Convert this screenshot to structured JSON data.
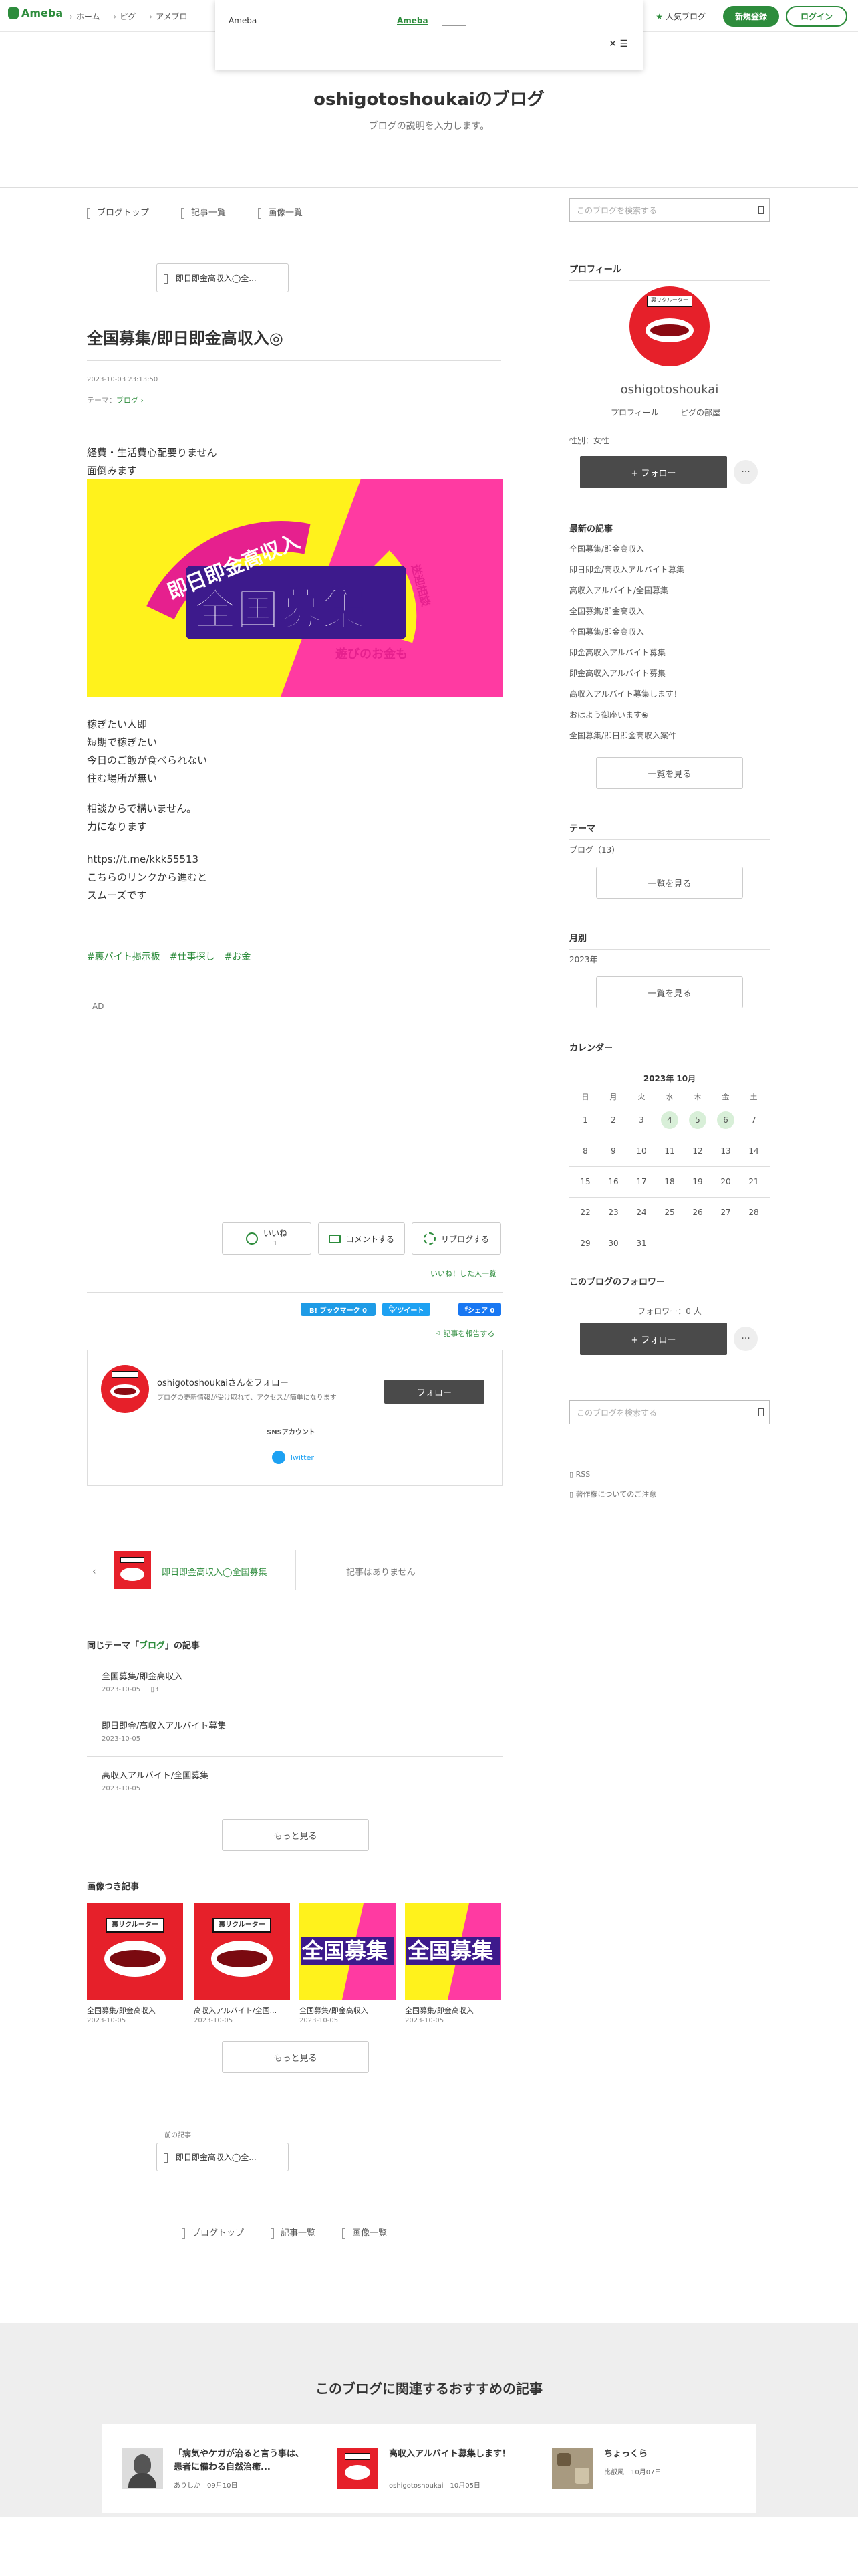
{
  "topbar": {
    "logo": "Ameba",
    "nav": [
      "ホーム",
      "ピグ",
      "アメブロ"
    ],
    "popular": "人気ブログ",
    "register": "新規登録",
    "login": "ログイン"
  },
  "popup": {
    "title": "Ameba",
    "link": "Ameba",
    "close": "✕ ☰"
  },
  "blog": {
    "title": "oshigotoshoukaiのブログ",
    "description": "ブログの説明を入力します。"
  },
  "blognav": {
    "items": [
      "ブログトップ",
      "記事一覧",
      "画像一覧"
    ],
    "search_placeholder": "このブログを検索する"
  },
  "article": {
    "prev_label": "即日即金高収入◯全...",
    "title": "全国募集/即日即金高収入◎",
    "date": "2023-10-03 23:13:50",
    "theme_label": "テーマ：",
    "theme": "ブログ",
    "para1": [
      "経費・生活費心配要りません",
      "面倒みます"
    ],
    "banner": {
      "arc_left": "即日即金高収入",
      "main": "全国募集",
      "arc_right": "遊びのお金も",
      "side_right": "送迎相談"
    },
    "para2": [
      "稼ぎたい人即",
      "短期で稼ぎたい",
      "今日のご飯が食べられない",
      "住む場所が無い"
    ],
    "para3": [
      "相談からで構いません。",
      "力になります"
    ],
    "para4": [
      "https://t.me/kkk55513",
      "こちらのリンクから進むと",
      "スムーズです"
    ],
    "hashtags": [
      "#裏バイト掲示板",
      "#仕事探し",
      "#お金"
    ],
    "ad": "AD"
  },
  "actions": {
    "like": "いいね",
    "like_count": "1",
    "comment": "コメントする",
    "reblog": "リブログする",
    "liked_by": "いいね！した人一覧",
    "bookmark": "B! ブックマーク 0",
    "tweet": "ツイート",
    "fb_share": "シェア 0",
    "report": "記事を報告する"
  },
  "follow_card": {
    "name": "oshigotoshoukaiさんをフォロー",
    "desc": "ブログの更新情報が受け取れて、アクセスが簡単になります",
    "button": "フォロー",
    "sns_label": "SNSアカウント",
    "twitter": "Twitter"
  },
  "nav_posts": {
    "prev_title": "即日即金高収入◯全国募集",
    "next_none": "記事はありません"
  },
  "same_theme": {
    "prefix": "同じテーマ「",
    "theme": "ブログ",
    "suffix": "」の記事",
    "items": [
      {
        "title": "全国募集/即金高収入",
        "date": "2023-10-05",
        "extra": "3"
      },
      {
        "title": "即日即金/高収入アルバイト募集",
        "date": "2023-10-05"
      },
      {
        "title": "高収入アルバイト/全国募集",
        "date": "2023-10-05"
      }
    ],
    "more": "もっと見る"
  },
  "image_posts": {
    "title": "画像つき記事",
    "items": [
      {
        "caption": "全国募集/即金高収入",
        "date": "2023-10-05",
        "kind": "lips"
      },
      {
        "caption": "高収入アルバイト/全国...",
        "date": "2023-10-05",
        "kind": "lips"
      },
      {
        "caption": "全国募集/即金高収入",
        "date": "2023-10-05",
        "kind": "banner"
      },
      {
        "caption": "全国募集/即金高収入",
        "date": "2023-10-05",
        "kind": "banner"
      }
    ],
    "lips_tag": "裏リクルーター",
    "banner_text": "全国募集",
    "more": "もっと見る"
  },
  "prev_post": {
    "label": "前の記事",
    "title": "即日即金高収入◯全..."
  },
  "bottomnav": [
    "ブログトップ",
    "記事一覧",
    "画像一覧"
  ],
  "sidebar": {
    "profile_title": "プロフィール",
    "profile_name": "oshigotoshoukai",
    "profile_link": "プロフィール",
    "pigg_link": "ピグの部屋",
    "gender": "性別：女性",
    "follow_button": "+ フォロー",
    "more_button": "···",
    "latest_title": "最新の記事",
    "latest": [
      "全国募集/即金高収入",
      "即日即金/高収入アルバイト募集",
      "高収入アルバイト/全国募集",
      "全国募集/即金高収入",
      "全国募集/即金高収入",
      "即金高収入アルバイト募集",
      "即金高収入アルバイト募集",
      "高収入アルバイト募集します！",
      "おはよう御座います❀",
      "全国募集/即日即金高収入案件"
    ],
    "see_all": "一覧を見る",
    "theme_title": "テーマ",
    "theme_item": "ブログ（13）",
    "monthly_title": "月別",
    "monthly_item": "2023年",
    "calendar_title": "カレンダー",
    "calendar_month": "2023年 10月",
    "weekdays": [
      "日",
      "月",
      "火",
      "水",
      "木",
      "金",
      "土"
    ],
    "highlight_days": [
      4,
      5,
      6
    ],
    "followers_title": "このブログのフォロワー",
    "followers_count": "フォロワー：0 人",
    "search_placeholder": "このブログを検索する",
    "rss": "RSS",
    "copyright": "著作権についてのご注意"
  },
  "recommend": {
    "title": "このブログに関連するおすすめの記事",
    "items": [
      {
        "title": "「病気やケガが治ると言う事は、患者に備わる自然治癒...",
        "author": "ありしか",
        "date": "09月10日"
      },
      {
        "title": "高収入アルバイト募集します！",
        "author": "oshigotoshoukai",
        "date": "10月05日"
      },
      {
        "title": "ちょっくら",
        "author": "比叡風",
        "date": "10月07日"
      }
    ]
  }
}
